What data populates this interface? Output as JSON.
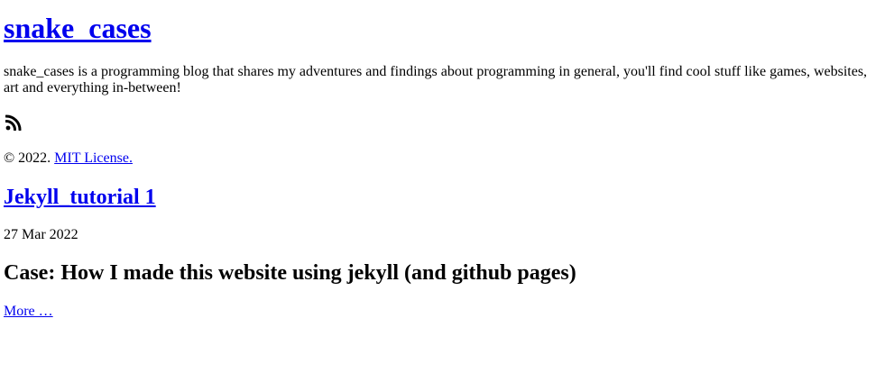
{
  "site": {
    "title": "snake_cases",
    "description": "snake_cases is a programming blog that shares my adventures and findings about programming in general, you'll find cool stuff like games, websites, art and everything in-between!",
    "rss_icon": "rss-icon"
  },
  "footer": {
    "copyright_prefix": "© 2022.",
    "license_link": "MIT License."
  },
  "posts": [
    {
      "title": "Jekyll_tutorial 1",
      "date": "27 Mar 2022",
      "excerpt_heading": "Case: How I made this website using jekyll (and github pages)",
      "more_link": "More …"
    }
  ]
}
